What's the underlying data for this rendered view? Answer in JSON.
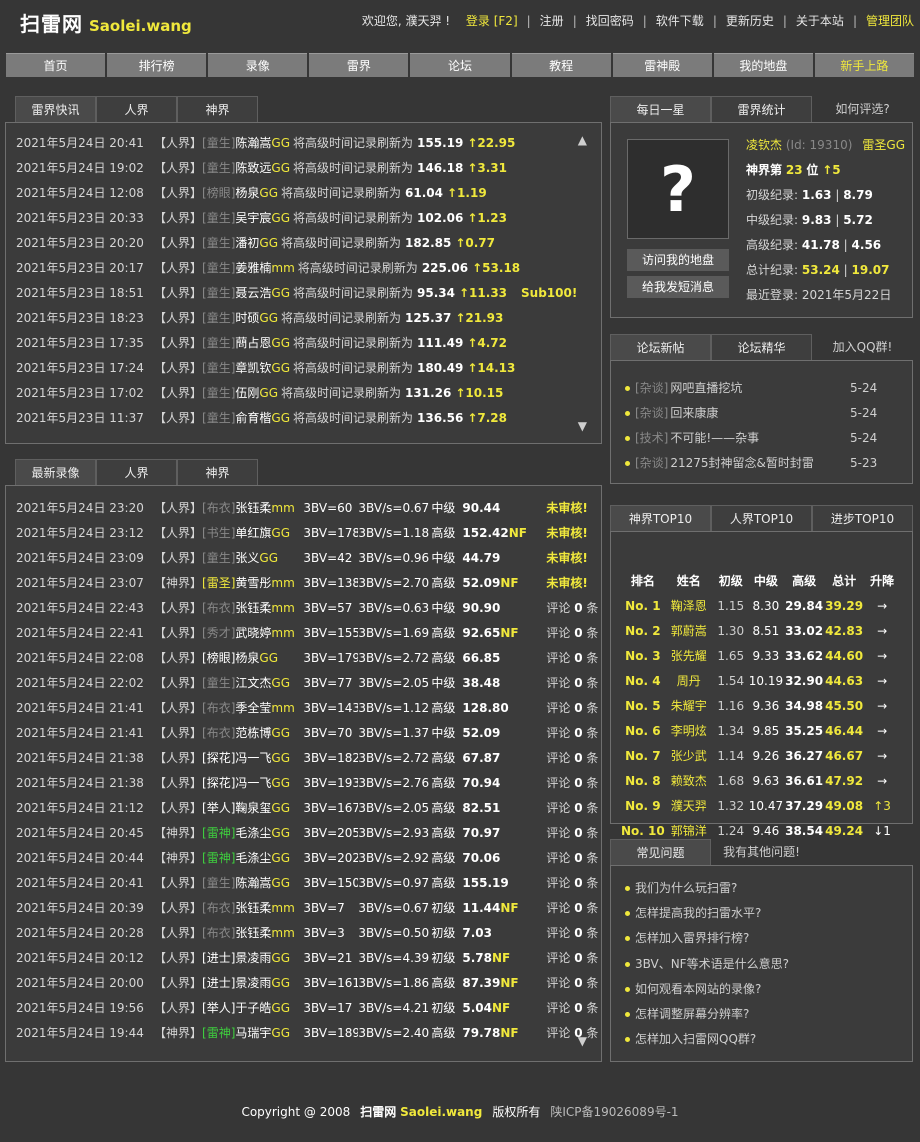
{
  "site": {
    "logo_cn": "扫雷网",
    "logo_en": "Saolei.wang"
  },
  "top": {
    "welcome": "欢迎您, 濮天羿 !",
    "login": "登录 [F2]",
    "links": [
      "注册",
      "找回密码",
      "软件下载",
      "更新历史",
      "关于本站"
    ],
    "admin": "管理团队"
  },
  "nav": [
    "首页",
    "排行榜",
    "录像",
    "雷界",
    "论坛",
    "教程",
    "雷神殿",
    "我的地盘",
    "新手上路"
  ],
  "news": {
    "tabs": [
      "雷界快讯",
      "人界",
      "神界"
    ],
    "up_arrow": "▲",
    "down_arrow": "▼",
    "items": [
      {
        "time": "2021年5月24日 20:41",
        "realm": "【人界】",
        "rank": "[童生]",
        "name": "陈瀚嵩",
        "suffix": "GG",
        "text": "将高级时间记录刷新为",
        "value": "155.19",
        "delta": "↑22.95",
        "extra": ""
      },
      {
        "time": "2021年5月24日 19:02",
        "realm": "【人界】",
        "rank": "[童生]",
        "name": "陈致远",
        "suffix": "GG",
        "text": "将高级时间记录刷新为",
        "value": "146.18",
        "delta": "↑3.31",
        "extra": ""
      },
      {
        "time": "2021年5月24日 12:08",
        "realm": "【人界】",
        "rank": "[榜眼]",
        "name": "杨泉",
        "suffix": "GG",
        "text": "将高级时间记录刷新为",
        "value": "61.04",
        "delta": "↑1.19",
        "extra": ""
      },
      {
        "time": "2021年5月23日 20:33",
        "realm": "【人界】",
        "rank": "[童生]",
        "name": "吴宇宸",
        "suffix": "GG",
        "text": "将高级时间记录刷新为",
        "value": "102.06",
        "delta": "↑1.23",
        "extra": ""
      },
      {
        "time": "2021年5月23日 20:20",
        "realm": "【人界】",
        "rank": "[童生]",
        "name": "潘初",
        "suffix": "GG",
        "text": "将高级时间记录刷新为",
        "value": "182.85",
        "delta": "↑0.77",
        "extra": ""
      },
      {
        "time": "2021年5月23日 20:17",
        "realm": "【人界】",
        "rank": "[童生]",
        "name": "姜雅楠",
        "suffix": "mm",
        "text": "将高级时间记录刷新为",
        "value": "225.06",
        "delta": "↑53.18",
        "extra": ""
      },
      {
        "time": "2021年5月23日 18:51",
        "realm": "【人界】",
        "rank": "[童生]",
        "name": "聂云浩",
        "suffix": "GG",
        "text": "将高级时间记录刷新为",
        "value": "95.34",
        "delta": "↑11.33",
        "extra": "Sub100!"
      },
      {
        "time": "2021年5月23日 18:23",
        "realm": "【人界】",
        "rank": "[童生]",
        "name": "时硕",
        "suffix": "GG",
        "text": "将高级时间记录刷新为",
        "value": "125.37",
        "delta": "↑21.93",
        "extra": ""
      },
      {
        "time": "2021年5月23日 17:35",
        "realm": "【人界】",
        "rank": "[童生]",
        "name": "蔄占恩",
        "suffix": "GG",
        "text": "将高级时间记录刷新为",
        "value": "111.49",
        "delta": "↑4.72",
        "extra": ""
      },
      {
        "time": "2021年5月23日 17:24",
        "realm": "【人界】",
        "rank": "[童生]",
        "name": "章凯钦",
        "suffix": "GG",
        "text": "将高级时间记录刷新为",
        "value": "180.49",
        "delta": "↑14.13",
        "extra": ""
      },
      {
        "time": "2021年5月23日 17:02",
        "realm": "【人界】",
        "rank": "[童生]",
        "name": "伍刚",
        "suffix": "GG",
        "text": "将高级时间记录刷新为",
        "value": "131.26",
        "delta": "↑10.15",
        "extra": ""
      },
      {
        "time": "2021年5月23日 11:37",
        "realm": "【人界】",
        "rank": "[童生]",
        "name": "俞育楷",
        "suffix": "GG",
        "text": "将高级时间记录刷新为",
        "value": "136.56",
        "delta": "↑7.28",
        "extra": ""
      }
    ]
  },
  "videos": {
    "tabs": [
      "最新录像",
      "人界",
      "神界"
    ],
    "down_arrow": "▼",
    "items": [
      {
        "time": "2021年5月24日 23:20",
        "realm": "【人界】",
        "rank": "[布衣]",
        "rank_color": "g",
        "name": "张钰柔",
        "suffix": "mm",
        "bv": "3BV=60",
        "bvs": "3BV/s=0.67",
        "level": "中级",
        "score": "90.44",
        "nf": "",
        "status": "未审核!",
        "reviewed": false,
        "comments": ""
      },
      {
        "time": "2021年5月24日 23:12",
        "realm": "【人界】",
        "rank": "[书生]",
        "rank_color": "g",
        "name": "单红旗",
        "suffix": "GG",
        "bv": "3BV=178",
        "bvs": "3BV/s=1.18",
        "level": "高级",
        "score": "152.42",
        "nf": "NF",
        "status": "未审核!",
        "reviewed": false,
        "comments": ""
      },
      {
        "time": "2021年5月24日 23:09",
        "realm": "【人界】",
        "rank": "[童生]",
        "rank_color": "g",
        "name": "张义",
        "suffix": "GG",
        "bv": "3BV=42",
        "bvs": "3BV/s=0.96",
        "level": "中级",
        "score": "44.79",
        "nf": "",
        "status": "未审核!",
        "reviewed": false,
        "comments": ""
      },
      {
        "time": "2021年5月24日 23:07",
        "realm": "【神界】",
        "rank": "[雷圣]",
        "rank_color": "y",
        "name": "黄雪彤",
        "suffix": "mm",
        "bv": "3BV=138",
        "bvs": "3BV/s=2.70",
        "level": "高级",
        "score": "52.09",
        "nf": "NF",
        "status": "未审核!",
        "reviewed": false,
        "comments": ""
      },
      {
        "time": "2021年5月24日 22:43",
        "realm": "【人界】",
        "rank": "[布衣]",
        "rank_color": "g",
        "name": "张钰柔",
        "suffix": "mm",
        "bv": "3BV=57",
        "bvs": "3BV/s=0.63",
        "level": "中级",
        "score": "90.90",
        "nf": "",
        "status": "评论",
        "reviewed": true,
        "comments": "0"
      },
      {
        "time": "2021年5月24日 22:41",
        "realm": "【人界】",
        "rank": "[秀才]",
        "rank_color": "g",
        "name": "武晓婷",
        "suffix": "mm",
        "bv": "3BV=155",
        "bvs": "3BV/s=1.69",
        "level": "高级",
        "score": "92.65",
        "nf": "NF",
        "status": "评论",
        "reviewed": true,
        "comments": "0"
      },
      {
        "time": "2021年5月24日 22:08",
        "realm": "【人界】",
        "rank": "[榜眼]",
        "rank_color": "w",
        "name": "杨泉",
        "suffix": "GG",
        "bv": "3BV=179",
        "bvs": "3BV/s=2.72",
        "level": "高级",
        "score": "66.85",
        "nf": "",
        "status": "评论",
        "reviewed": true,
        "comments": "0"
      },
      {
        "time": "2021年5月24日 22:02",
        "realm": "【人界】",
        "rank": "[童生]",
        "rank_color": "g",
        "name": "江文杰",
        "suffix": "GG",
        "bv": "3BV=77",
        "bvs": "3BV/s=2.05",
        "level": "中级",
        "score": "38.48",
        "nf": "",
        "status": "评论",
        "reviewed": true,
        "comments": "0"
      },
      {
        "time": "2021年5月24日 21:41",
        "realm": "【人界】",
        "rank": "[布衣]",
        "rank_color": "g",
        "name": "季全莹",
        "suffix": "mm",
        "bv": "3BV=143",
        "bvs": "3BV/s=1.12",
        "level": "高级",
        "score": "128.80",
        "nf": "",
        "status": "评论",
        "reviewed": true,
        "comments": "0"
      },
      {
        "time": "2021年5月24日 21:41",
        "realm": "【人界】",
        "rank": "[布衣]",
        "rank_color": "g",
        "name": "范栋博",
        "suffix": "GG",
        "bv": "3BV=70",
        "bvs": "3BV/s=1.37",
        "level": "中级",
        "score": "52.09",
        "nf": "",
        "status": "评论",
        "reviewed": true,
        "comments": "0"
      },
      {
        "time": "2021年5月24日 21:38",
        "realm": "【人界】",
        "rank": "[探花]",
        "rank_color": "w",
        "name": "冯一飞",
        "suffix": "GG",
        "bv": "3BV=182",
        "bvs": "3BV/s=2.72",
        "level": "高级",
        "score": "67.87",
        "nf": "",
        "status": "评论",
        "reviewed": true,
        "comments": "0"
      },
      {
        "time": "2021年5月24日 21:38",
        "realm": "【人界】",
        "rank": "[探花]",
        "rank_color": "w",
        "name": "冯一飞",
        "suffix": "GG",
        "bv": "3BV=193",
        "bvs": "3BV/s=2.76",
        "level": "高级",
        "score": "70.94",
        "nf": "",
        "status": "评论",
        "reviewed": true,
        "comments": "0"
      },
      {
        "time": "2021年5月24日 21:12",
        "realm": "【人界】",
        "rank": "[举人]",
        "rank_color": "w",
        "name": "鞠泉玺",
        "suffix": "GG",
        "bv": "3BV=167",
        "bvs": "3BV/s=2.05",
        "level": "高级",
        "score": "82.51",
        "nf": "",
        "status": "评论",
        "reviewed": true,
        "comments": "0"
      },
      {
        "time": "2021年5月24日 20:45",
        "realm": "【神界】",
        "rank": "[雷神]",
        "rank_color": "grn",
        "name": "毛涤尘",
        "suffix": "GG",
        "bv": "3BV=205",
        "bvs": "3BV/s=2.93",
        "level": "高级",
        "score": "70.97",
        "nf": "",
        "status": "评论",
        "reviewed": true,
        "comments": "0"
      },
      {
        "time": "2021年5月24日 20:44",
        "realm": "【神界】",
        "rank": "[雷神]",
        "rank_color": "grn",
        "name": "毛涤尘",
        "suffix": "GG",
        "bv": "3BV=202",
        "bvs": "3BV/s=2.92",
        "level": "高级",
        "score": "70.06",
        "nf": "",
        "status": "评论",
        "reviewed": true,
        "comments": "0"
      },
      {
        "time": "2021年5月24日 20:41",
        "realm": "【人界】",
        "rank": "[童生]",
        "rank_color": "g",
        "name": "陈瀚嵩",
        "suffix": "GG",
        "bv": "3BV=150",
        "bvs": "3BV/s=0.97",
        "level": "高级",
        "score": "155.19",
        "nf": "",
        "status": "评论",
        "reviewed": true,
        "comments": "0"
      },
      {
        "time": "2021年5月24日 20:39",
        "realm": "【人界】",
        "rank": "[布衣]",
        "rank_color": "g",
        "name": "张钰柔",
        "suffix": "mm",
        "bv": "3BV=7",
        "bvs": "3BV/s=0.67",
        "level": "初级",
        "score": "11.44",
        "nf": "NF",
        "status": "评论",
        "reviewed": true,
        "comments": "0"
      },
      {
        "time": "2021年5月24日 20:28",
        "realm": "【人界】",
        "rank": "[布衣]",
        "rank_color": "g",
        "name": "张钰柔",
        "suffix": "mm",
        "bv": "3BV=3",
        "bvs": "3BV/s=0.50",
        "level": "初级",
        "score": "7.03",
        "nf": "",
        "status": "评论",
        "reviewed": true,
        "comments": "0"
      },
      {
        "time": "2021年5月24日 20:12",
        "realm": "【人界】",
        "rank": "[进士]",
        "rank_color": "w",
        "name": "景凌雨",
        "suffix": "GG",
        "bv": "3BV=21",
        "bvs": "3BV/s=4.39",
        "level": "初级",
        "score": "5.78",
        "nf": "NF",
        "status": "评论",
        "reviewed": true,
        "comments": "0"
      },
      {
        "time": "2021年5月24日 20:00",
        "realm": "【人界】",
        "rank": "[进士]",
        "rank_color": "w",
        "name": "景凌雨",
        "suffix": "GG",
        "bv": "3BV=161",
        "bvs": "3BV/s=1.86",
        "level": "高级",
        "score": "87.39",
        "nf": "NF",
        "status": "评论",
        "reviewed": true,
        "comments": "0"
      },
      {
        "time": "2021年5月24日 19:56",
        "realm": "【人界】",
        "rank": "[举人]",
        "rank_color": "w",
        "name": "于子皓",
        "suffix": "GG",
        "bv": "3BV=17",
        "bvs": "3BV/s=4.21",
        "level": "初级",
        "score": "5.04",
        "nf": "NF",
        "status": "评论",
        "reviewed": true,
        "comments": "0"
      },
      {
        "time": "2021年5月24日 19:44",
        "realm": "【神界】",
        "rank": "[雷神]",
        "rank_color": "grn",
        "name": "马瑞宇",
        "suffix": "GG",
        "bv": "3BV=189",
        "bvs": "3BV/s=2.40",
        "level": "高级",
        "score": "79.78",
        "nf": "NF",
        "status": "评论",
        "reviewed": true,
        "comments": "0"
      }
    ],
    "comment_unit": "条"
  },
  "star": {
    "tabs": [
      "每日一星",
      "雷界统计",
      "如何评选?"
    ],
    "avatar": "?",
    "name": "凌钦杰",
    "id": "(Id: 19310)",
    "title": "雷圣GG",
    "rank_label": "神界第",
    "rank_num": "23",
    "rank_unit": "位",
    "rank_delta": "↑5",
    "records": [
      {
        "label": "初级纪录:",
        "time": "1.63",
        "sep": "|",
        "bvs": "8.79"
      },
      {
        "label": "中级纪录:",
        "time": "9.83",
        "sep": "|",
        "bvs": "5.72"
      },
      {
        "label": "高级纪录:",
        "time": "41.78",
        "sep": "|",
        "bvs": "4.56"
      },
      {
        "label": "总计纪录:",
        "time": "53.24",
        "sep": "|",
        "bvs": "19.07"
      }
    ],
    "last_login_label": "最近登录:",
    "last_login": "2021年5月22日",
    "btn_visit": "访问我的地盘",
    "btn_msg": "给我发短消息"
  },
  "forum": {
    "tabs": [
      "论坛新帖",
      "论坛精华",
      "加入QQ群!"
    ],
    "items": [
      {
        "cat": "[杂谈]",
        "title": "网吧直播挖坑",
        "date": "5-24"
      },
      {
        "cat": "[杂谈]",
        "title": "回来康康",
        "date": "5-24"
      },
      {
        "cat": "[技术]",
        "title": "不可能!——杂事",
        "date": "5-24"
      },
      {
        "cat": "[杂谈]",
        "title": "21275封神留念&暂时封雷",
        "date": "5-23"
      }
    ]
  },
  "top10": {
    "tabs": [
      "神界TOP10",
      "人界TOP10",
      "进步TOP10"
    ],
    "headers": [
      "排名",
      "姓名",
      "初级",
      "中级",
      "高级",
      "总计",
      "升降"
    ],
    "rows": [
      {
        "rank": "No. 1",
        "name": "鞠泽恩",
        "b": "1.15",
        "i": "8.30",
        "e": "29.84",
        "total": "39.29",
        "change": "→"
      },
      {
        "rank": "No. 2",
        "name": "郭蔚嵩",
        "b": "1.30",
        "i": "8.51",
        "e": "33.02",
        "total": "42.83",
        "change": "→"
      },
      {
        "rank": "No. 3",
        "name": "张先耀",
        "b": "1.65",
        "i": "9.33",
        "e": "33.62",
        "total": "44.60",
        "change": "→"
      },
      {
        "rank": "No. 4",
        "name": "周丹",
        "b": "1.54",
        "i": "10.19",
        "e": "32.90",
        "total": "44.63",
        "change": "→"
      },
      {
        "rank": "No. 5",
        "name": "朱耀宇",
        "b": "1.16",
        "i": "9.36",
        "e": "34.98",
        "total": "45.50",
        "change": "→"
      },
      {
        "rank": "No. 6",
        "name": "李明炫",
        "b": "1.34",
        "i": "9.85",
        "e": "35.25",
        "total": "46.44",
        "change": "→"
      },
      {
        "rank": "No. 7",
        "name": "张少武",
        "b": "1.14",
        "i": "9.26",
        "e": "36.27",
        "total": "46.67",
        "change": "→"
      },
      {
        "rank": "No. 8",
        "name": "赖致杰",
        "b": "1.68",
        "i": "9.63",
        "e": "36.61",
        "total": "47.92",
        "change": "→"
      },
      {
        "rank": "No. 9",
        "name": "濮天羿",
        "b": "1.32",
        "i": "10.47",
        "e": "37.29",
        "total": "49.08",
        "change": "↑3"
      },
      {
        "rank": "No. 10",
        "name": "郭锦洋",
        "b": "1.24",
        "i": "9.46",
        "e": "38.54",
        "total": "49.24",
        "change": "↓1"
      }
    ]
  },
  "faq": {
    "tabs": [
      "常见问题",
      "我有其他问题!"
    ],
    "items": [
      "我们为什么玩扫雷?",
      "怎样提高我的扫雷水平?",
      "怎样加入雷界排行榜?",
      "3BV、NF等术语是什么意思?",
      "如何观看本网站的录像?",
      "怎样调整屏幕分辨率?",
      "怎样加入扫雷网QQ群?"
    ]
  },
  "footer": {
    "copyright": "Copyright @ 2008",
    "site_cn": "扫雷网",
    "site_en": "Saolei.wang",
    "rights": "版权所有",
    "icp": "陕ICP备19026089号-1"
  }
}
